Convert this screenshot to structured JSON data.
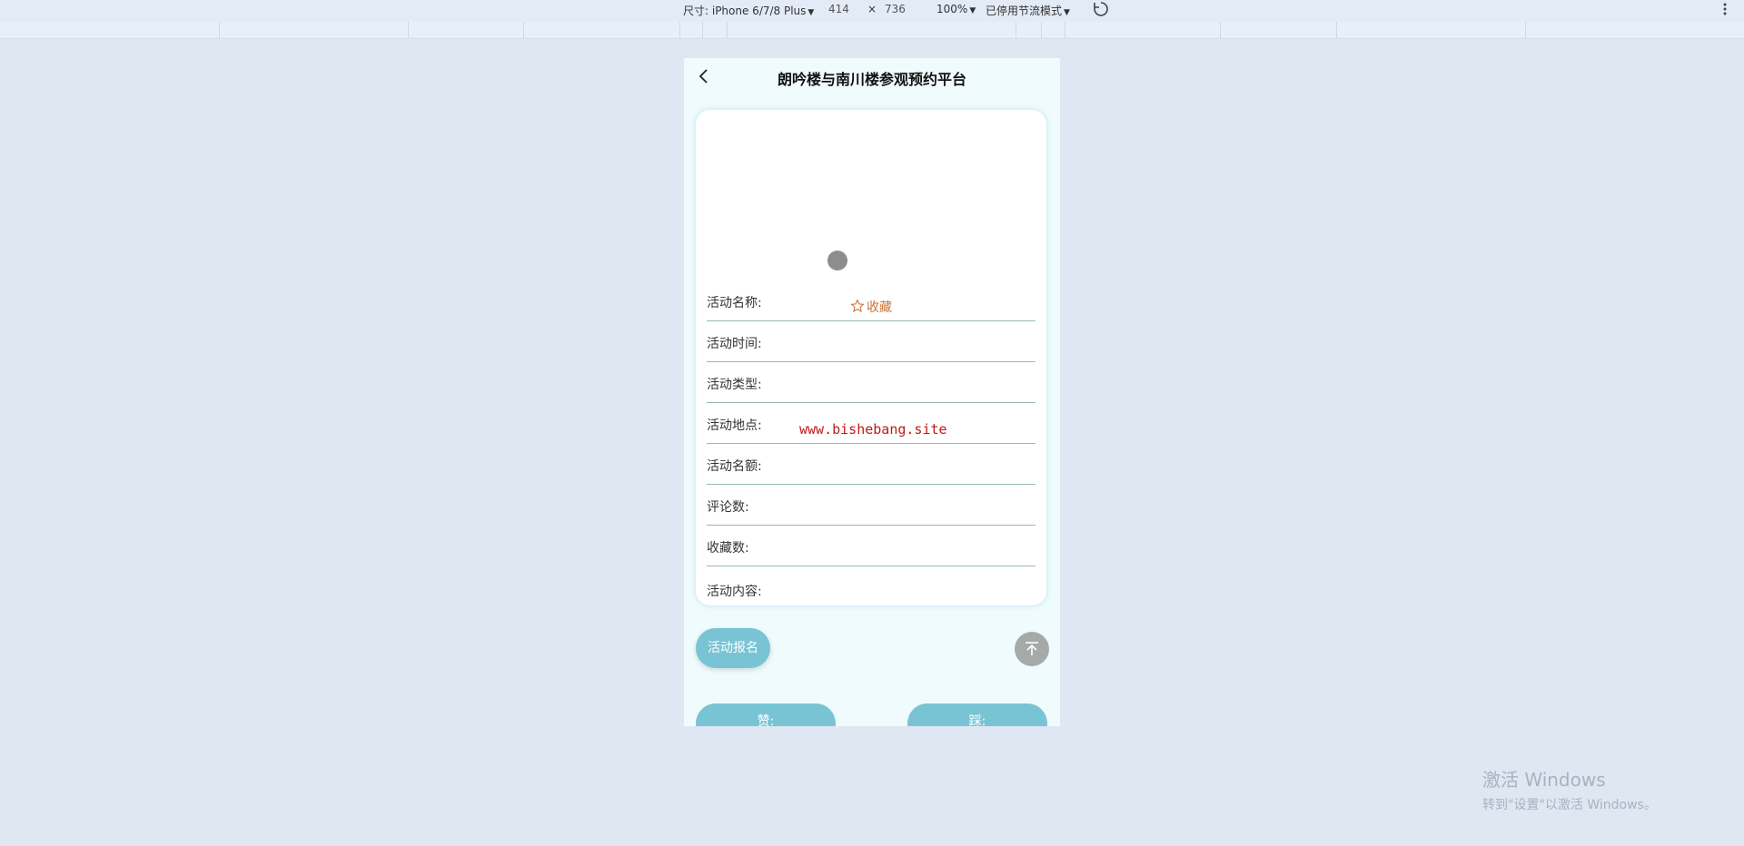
{
  "devtools": {
    "device_label": "尺寸: iPhone 6/7/8 Plus",
    "width": "414",
    "times": "×",
    "height": "736",
    "zoom": "100%",
    "throttle": "已停用节流模式",
    "rotate_icon": "rotate-icon",
    "more_icon": "more-vertical-icon"
  },
  "header": {
    "title": "朗吟楼与南川楼参观预约平台",
    "back_icon": "chevron-left-icon"
  },
  "detail": {
    "favorite_label": "收藏",
    "favorite_icon": "star-outline-icon",
    "fields": [
      {
        "label": "活动名称:"
      },
      {
        "label": "活动时间:"
      },
      {
        "label": "活动类型:"
      },
      {
        "label": "活动地点:"
      },
      {
        "label": "活动名额:"
      },
      {
        "label": "评论数:"
      },
      {
        "label": "收藏数:"
      },
      {
        "label": "活动内容:"
      }
    ]
  },
  "actions": {
    "signup_label": "活动报名",
    "like_label": "赞:",
    "dislike_label": "踩:",
    "scroll_top_icon": "arrow-up-to-top-icon"
  },
  "watermark": "www.bishebang.site",
  "windows_activation": {
    "line1": "激活 Windows",
    "line2": "转到\"设置\"以激活 Windows。"
  },
  "colors": {
    "accent": "#79c4d4",
    "favorite": "#c9743a",
    "watermark": "#c41818"
  }
}
